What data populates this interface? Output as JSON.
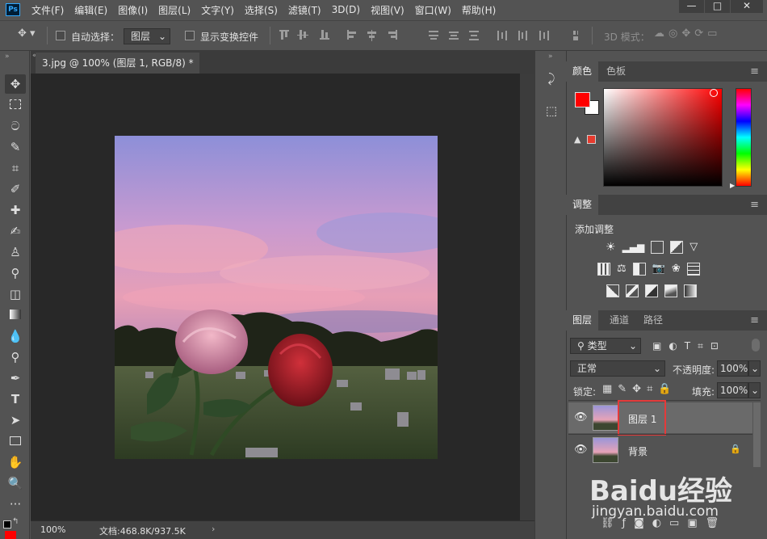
{
  "app": {
    "logo": "Ps"
  },
  "menu": [
    "文件(F)",
    "编辑(E)",
    "图像(I)",
    "图层(L)",
    "文字(Y)",
    "选择(S)",
    "滤镜(T)",
    "3D(D)",
    "视图(V)",
    "窗口(W)",
    "帮助(H)"
  ],
  "window_controls": {
    "minimize": "—",
    "maximize": "□",
    "close": "✕"
  },
  "options": {
    "auto_select_label": "自动选择：",
    "auto_select_value": "图层",
    "show_transform_label": "显示变换控件",
    "mode_3d_label": "3D 模式："
  },
  "document": {
    "tab_title": "3.jpg @ 100% (图层 1, RGB/8) *",
    "zoom": "100%",
    "doc_info": "文档:468.8K/937.5K"
  },
  "color_panel": {
    "tabs": [
      "颜色",
      "色板"
    ],
    "foreground": "#ff0000",
    "background": "#ffffff"
  },
  "adjustments_panel": {
    "tab": "调整",
    "add_label": "添加调整"
  },
  "layers_panel": {
    "tabs": [
      "图层",
      "通道",
      "路径"
    ],
    "filter_kind": "类型",
    "blend_mode": "正常",
    "opacity_label": "不透明度:",
    "opacity_value": "100%",
    "lock_label": "锁定:",
    "fill_label": "填充:",
    "fill_value": "100%",
    "layers": [
      {
        "name": "图层 1",
        "selected": true,
        "visible": true
      },
      {
        "name": "背景",
        "selected": false,
        "visible": true,
        "locked": true
      }
    ]
  },
  "watermark": {
    "brand": "Baidu经验",
    "url": "jingyan.baidu.com"
  }
}
